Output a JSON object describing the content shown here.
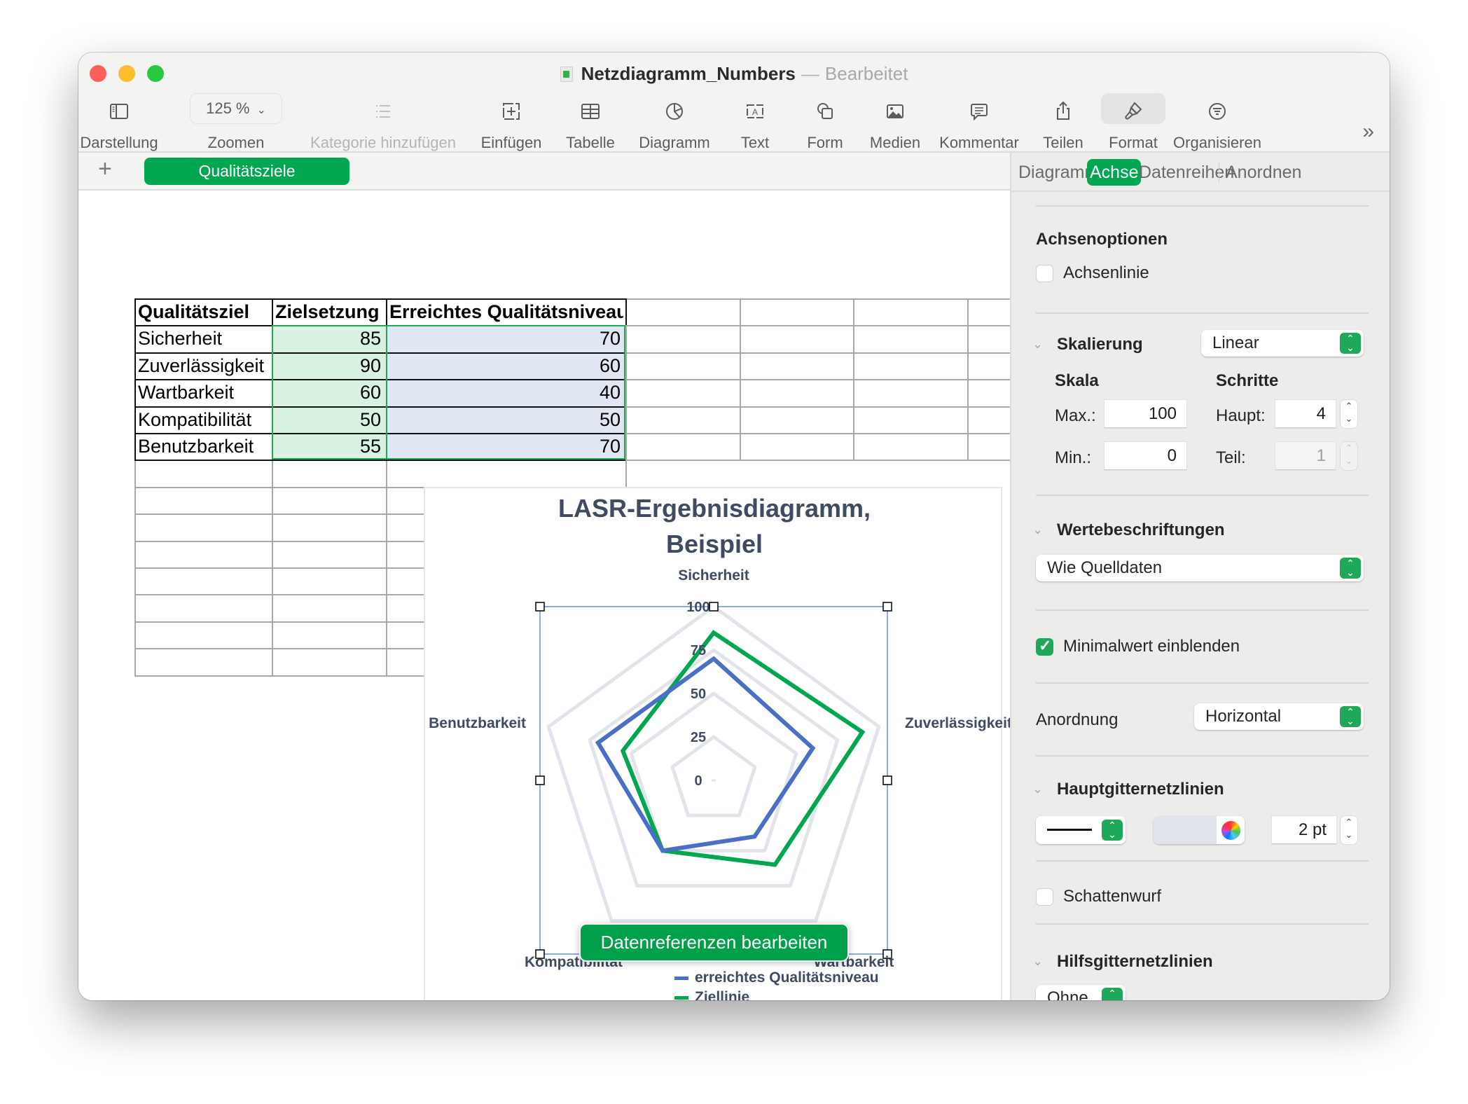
{
  "window": {
    "title": "Netzdiagramm_Numbers",
    "separator": "—",
    "status": "Bearbeitet"
  },
  "toolbar": {
    "items": [
      {
        "label": "Darstellung",
        "icon": "sidebar-icon",
        "disabled": false
      },
      {
        "label": "Zoomen",
        "icon": "zoom-popup",
        "value": "125 %",
        "disabled": false
      },
      {
        "label": "Kategorie hinzufügen",
        "icon": "list-icon",
        "disabled": true
      },
      {
        "label": "Einfügen",
        "icon": "insert-icon",
        "disabled": false
      },
      {
        "label": "Tabelle",
        "icon": "table-icon",
        "disabled": false
      },
      {
        "label": "Diagramm",
        "icon": "chart-icon",
        "disabled": false
      },
      {
        "label": "Text",
        "icon": "text-icon",
        "disabled": false
      },
      {
        "label": "Form",
        "icon": "shape-icon",
        "disabled": false
      },
      {
        "label": "Medien",
        "icon": "media-icon",
        "disabled": false
      },
      {
        "label": "Kommentar",
        "icon": "comment-icon",
        "disabled": false
      },
      {
        "label": "Teilen",
        "icon": "share-icon",
        "disabled": false
      },
      {
        "label": "Format",
        "icon": "paintbrush-icon",
        "disabled": false,
        "active": true
      },
      {
        "label": "Organisieren",
        "icon": "organize-icon",
        "disabled": false
      }
    ],
    "more": "»"
  },
  "tabbar": {
    "add": "+",
    "sheets": [
      {
        "label": "Qualitätsziele",
        "active": true
      }
    ]
  },
  "table": {
    "headers": [
      "Qualitätsziel",
      "Zielsetzung",
      "Erreichtes Qualitätsniveau"
    ],
    "rows": [
      [
        "Sicherheit",
        "85",
        "70"
      ],
      [
        "Zuverlässigkeit",
        "90",
        "60"
      ],
      [
        "Wartbarkeit",
        "60",
        "40"
      ],
      [
        "Kompatibilität",
        "50",
        "50"
      ],
      [
        "Benutzbarkeit",
        "55",
        "70"
      ]
    ]
  },
  "chart_data": {
    "type": "radar",
    "title": "LASR-Ergebnisdiagramm, Beispiel",
    "title_lines": [
      "LASR-Ergebnisdiagramm,",
      "Beispiel"
    ],
    "categories": [
      "Sicherheit",
      "Zuverlässigkeit",
      "Wartbarkeit",
      "Kompatibilität",
      "Benutzbarkeit"
    ],
    "category_labels_visible": [
      "Sicherheit",
      "Zuverlässigkeit",
      "Wartbarkeit",
      "Kompatibilität",
      "Benutzbarkeit"
    ],
    "series": [
      {
        "name": "erreichtes Qualitätsniveau",
        "values": [
          70,
          60,
          40,
          50,
          70
        ],
        "color": "#4a6fc4"
      },
      {
        "name": "Ziellinie",
        "values": [
          85,
          90,
          60,
          50,
          55
        ],
        "color": "#00a650"
      }
    ],
    "axis": {
      "min": 0,
      "max": 100,
      "ticks": [
        0,
        25,
        50,
        75,
        100
      ]
    },
    "grid": true,
    "grid_color": "#e1e5eb",
    "legend": "bottom"
  },
  "chart_ui": {
    "edit_button": "Datenreferenzen bearbeiten"
  },
  "sidebar": {
    "tabs": [
      {
        "label": "Diagramm",
        "active": false
      },
      {
        "label": "Achse",
        "active": true
      },
      {
        "label": "Datenreihen",
        "active": false
      },
      {
        "label": "Anordnen",
        "active": false
      }
    ],
    "axis_options": {
      "heading": "Achsenoptionen",
      "axis_line": {
        "label": "Achsenlinie",
        "checked": false
      }
    },
    "scale": {
      "heading": "Skalierung",
      "type": "Linear",
      "scale_heading": "Skala",
      "steps_heading": "Schritte",
      "max_label": "Max.:",
      "max_value": "100",
      "min_label": "Min.:",
      "min_value": "0",
      "major_label": "Haupt:",
      "major_value": "4",
      "minor_label": "Teil:",
      "minor_value": "1"
    },
    "value_labels": {
      "heading": "Wertebeschriftungen",
      "value": "Wie Quelldaten"
    },
    "show_min": {
      "label": "Minimalwert einblenden",
      "checked": true
    },
    "arrangement": {
      "label": "Anordnung",
      "value": "Horizontal"
    },
    "major_grid": {
      "heading": "Hauptgitternetzlinien",
      "line_style": "solid",
      "color": "#e1e5eb",
      "width": "2 pt"
    },
    "shadow": {
      "label": "Schattenwurf",
      "checked": false
    },
    "minor_grid": {
      "heading": "Hilfsgitternetzlinien",
      "value": "Ohne"
    }
  }
}
